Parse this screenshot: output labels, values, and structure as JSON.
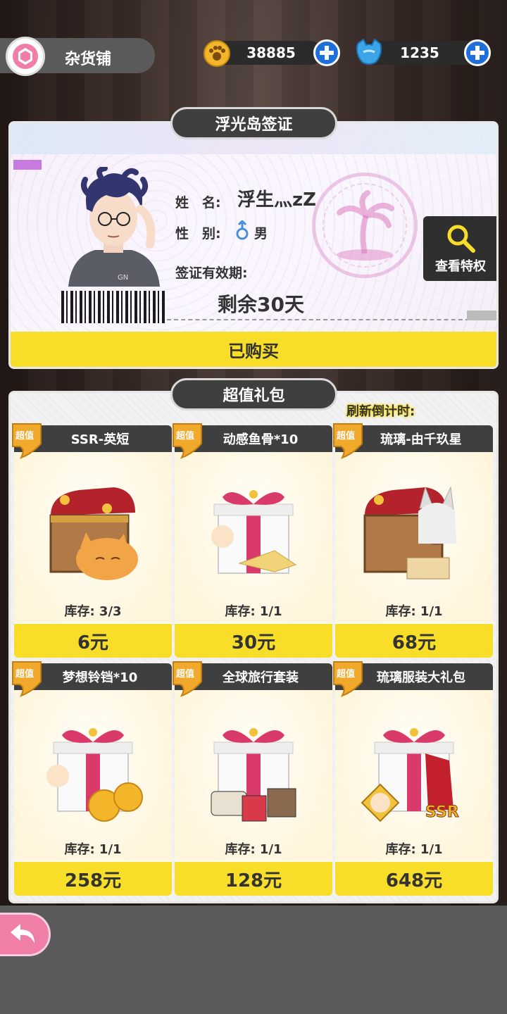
{
  "header": {
    "shop_title": "杂货铺",
    "coins": "38885",
    "gems": "1235"
  },
  "visa": {
    "section_title": "浮光岛签证",
    "name_label": "姓　名:",
    "name_value": "浮生灬zZ",
    "gender_label": "性　别:",
    "gender_value": "男",
    "validity_label": "签证有效期:",
    "validity_value": "剩余30天",
    "perks_button": "查看特权",
    "status": "已购买"
  },
  "gifts": {
    "section_title": "超值礼包",
    "countdown_label": "刷新倒计时:",
    "badge_label": "超值",
    "items": [
      {
        "name": "SSR-英短",
        "stock": "库存: 3/3",
        "price": "6元"
      },
      {
        "name": "动感鱼骨*10",
        "stock": "库存: 1/1",
        "price": "30元"
      },
      {
        "name": "琉璃-由千玖星",
        "stock": "库存: 1/1",
        "price": "68元"
      },
      {
        "name": "梦想铃铛*10",
        "stock": "库存: 1/1",
        "price": "258元"
      },
      {
        "name": "全球旅行套装",
        "stock": "库存: 1/1",
        "price": "128元"
      },
      {
        "name": "琉璃服装大礼包",
        "stock": "库存: 1/1",
        "price": "648元"
      }
    ]
  },
  "colors": {
    "accent_yellow": "#f8de28",
    "header_dark": "#3f3f3f",
    "plus_blue": "#1e6fd9",
    "back_pink": "#f07ea6"
  }
}
